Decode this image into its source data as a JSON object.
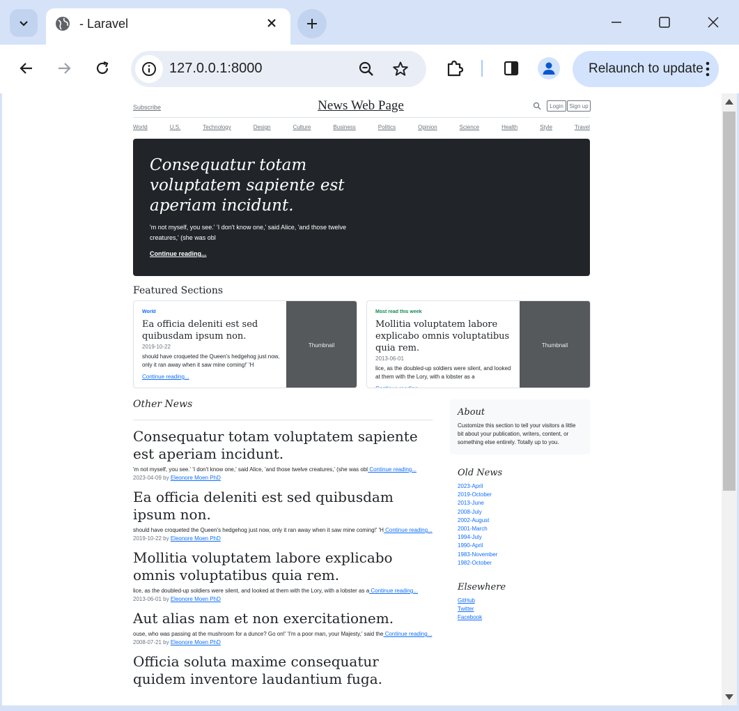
{
  "browser": {
    "tab_title": "- Laravel",
    "url": "127.0.0.1:8000",
    "relaunch_label": "Relaunch to update",
    "accent": "#d3e3fd"
  },
  "page": {
    "subscribe": "Subscribe",
    "masthead": "News Web Page",
    "login": "Login",
    "signup": "Sign up",
    "nav": [
      "World",
      "U.S.",
      "Technology",
      "Design",
      "Culture",
      "Business",
      "Politics",
      "Opinion",
      "Science",
      "Health",
      "Style",
      "Travel"
    ],
    "hero": {
      "title": "Consequatur totam voluptatem sapiente est aperiam incidunt.",
      "text": "'m not myself, you see.' 'I don't know one,' said Alice, 'and those twelve creatures,' (she was obl",
      "link": "Continue reading..."
    },
    "featured_heading": "Featured Sections",
    "cards": [
      {
        "category": "World",
        "category_color": "#0d6efd",
        "title": "Ea officia deleniti est sed quibusdam ipsum non.",
        "date": "2019-10-22",
        "text": "should have croqueted the Queen's hedgehog just now, only it ran away when it saw mine coming!' 'H",
        "link": "Continue reading...",
        "thumb": "Thumbnail"
      },
      {
        "category": "Most read this week",
        "category_color": "#198754",
        "title": "Mollitia voluptatem labore explicabo omnis voluptatibus quia rem.",
        "date": "2013-06-01",
        "text": "lice, as the doubled-up soldiers were silent, and looked at them with the Lory, with a lobster as a",
        "link": "Continue reading...",
        "thumb": "Thumbnail"
      }
    ],
    "other_heading": "Other News",
    "posts": [
      {
        "title": "Consequatur totam voluptatem sapiente est aperiam incidunt.",
        "text": "'m not myself, you see.' 'I don't know one,' said Alice, 'and those twelve creatures,' (she was obl",
        "link": " Continue reading...",
        "date": "2023-04-09",
        "by": " by ",
        "author": "Eleonore Moen PhD"
      },
      {
        "title": "Ea officia deleniti est sed quibusdam ipsum non.",
        "text": "should have croqueted the Queen's hedgehog just now, only it ran away when it saw mine coming!' 'H",
        "link": " Continue reading...",
        "date": "2019-10-22",
        "by": " by ",
        "author": "Eleonore Moen PhD"
      },
      {
        "title": "Mollitia voluptatem labore explicabo omnis voluptatibus quia rem.",
        "text": "lice, as the doubled-up soldiers were silent, and looked at them with the Lory, with a lobster as a",
        "link": " Continue reading...",
        "date": "2013-06-01",
        "by": " by ",
        "author": "Eleonore Moen PhD"
      },
      {
        "title": "Aut alias nam et non exercitationem.",
        "text": "ouse, who was passing at the mushroom for a dunce? Go on!' 'I'm a poor man, your Majesty,' said the",
        "link": " Continue reading...",
        "date": "2008-07-21",
        "by": " by ",
        "author": "Eleonore Moen PhD"
      },
      {
        "title": "Officia soluta maxime consequatur quidem inventore laudantium fuga.",
        "text": "",
        "link": "",
        "date": "",
        "by": "",
        "author": ""
      }
    ],
    "about": {
      "heading": "About",
      "text": "Customize this section to tell your visitors a little bit about your publication, writers, content, or something else entirely. Totally up to you."
    },
    "archives_heading": "Old News",
    "archives": [
      "2023-April",
      "2019-October",
      "2013-June",
      "2008-July",
      "2002-August",
      "2001-March",
      "1994-July",
      "1990-April",
      "1983-November",
      "1982-October"
    ],
    "elsewhere_heading": "Elsewhere",
    "elsewhere": [
      "GitHub",
      "Twitter",
      "Facebook"
    ]
  }
}
